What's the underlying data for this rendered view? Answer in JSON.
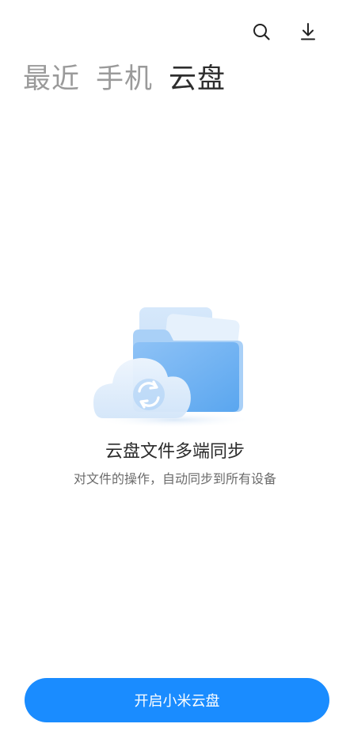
{
  "toolbar": {
    "search_icon": "search-icon",
    "download_icon": "download-icon",
    "more_icon": "more-vertical-icon",
    "notification_dot_color": "#e8252a"
  },
  "tabs": [
    {
      "label": "最近",
      "active": false
    },
    {
      "label": "手机",
      "active": false
    },
    {
      "label": "云盘",
      "active": true
    }
  ],
  "empty_state": {
    "illustration": "cloud-sync-folder-illustration",
    "title": "云盘文件多端同步",
    "subtitle": "对文件的操作，自动同步到所有设备"
  },
  "primary_button": {
    "label": "开启小米云盘",
    "color": "#1a8cff"
  }
}
